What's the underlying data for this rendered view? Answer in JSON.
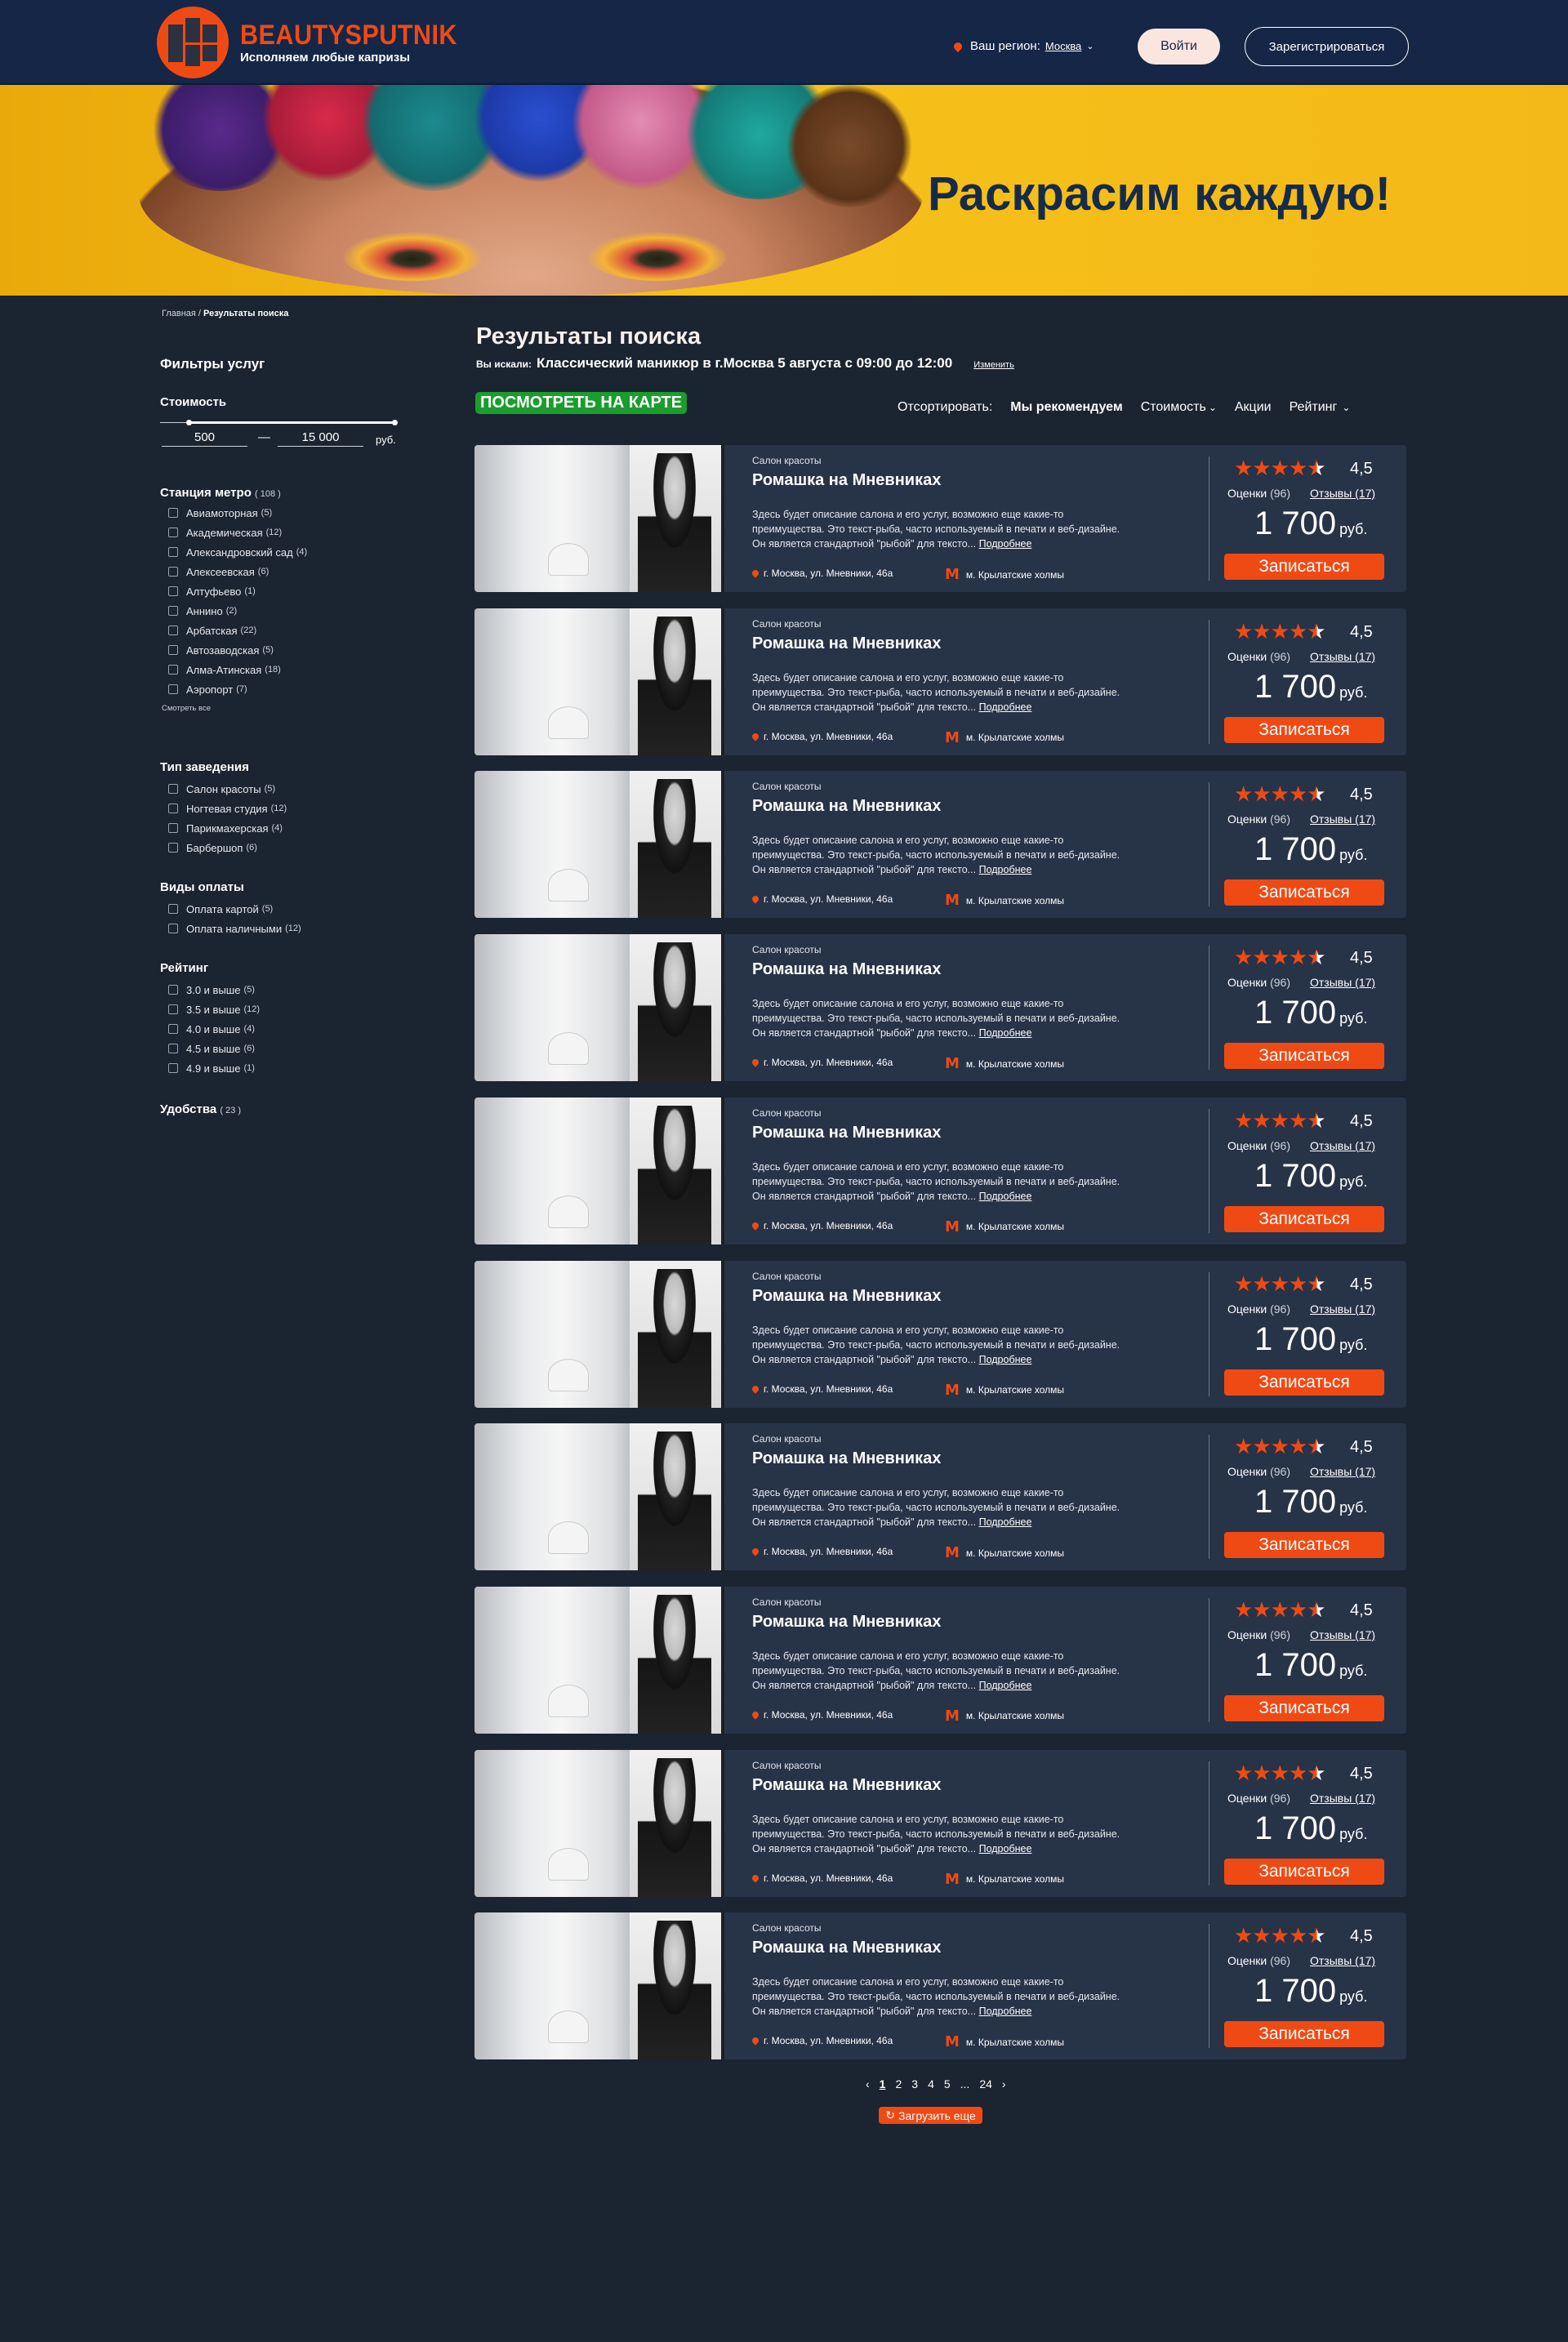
{
  "header": {
    "brand": "BEAUTYSPUTNIK",
    "tagline": "Исполняем любые капризы",
    "region_label": "Ваш регион:",
    "region_value": "Москва",
    "login": "Войти",
    "register": "Зарегистрироваться"
  },
  "banner": {
    "slogan": "Раскрасим каждую!"
  },
  "breadcrumb": {
    "home": "Главная",
    "sep": " / ",
    "current": "Результаты поиска"
  },
  "sidebar": {
    "title": "Фильтры услуг",
    "cost": {
      "label": "Стоимость",
      "from": "500",
      "dash": "—",
      "to": "15 000",
      "unit": "руб."
    },
    "metro": {
      "label": "Станция метро",
      "count": "( 108 )",
      "items": [
        {
          "label": "Авиамоторная",
          "count": "(5)"
        },
        {
          "label": "Академическая",
          "count": "(12)"
        },
        {
          "label": "Александровский сад",
          "count": "(4)"
        },
        {
          "label": "Алексеевская",
          "count": "(6)"
        },
        {
          "label": "Алтуфьево",
          "count": "(1)"
        },
        {
          "label": "Аннино",
          "count": "(2)"
        },
        {
          "label": "Арбатская",
          "count": "(22)"
        },
        {
          "label": "Автозаводская",
          "count": "(5)"
        },
        {
          "label": "Алма-Атинская",
          "count": "(18)"
        },
        {
          "label": "Аэропорт",
          "count": "(7)"
        }
      ],
      "show_all": "Смотреть все"
    },
    "venue": {
      "label": "Тип заведения",
      "items": [
        {
          "label": "Салон красоты",
          "count": "(5)"
        },
        {
          "label": "Ногтевая студия",
          "count": "(12)"
        },
        {
          "label": "Парикмахерская",
          "count": "(4)"
        },
        {
          "label": "Барбершоп",
          "count": "(6)"
        }
      ]
    },
    "payment": {
      "label": "Виды оплаты",
      "items": [
        {
          "label": "Оплата картой",
          "count": "(5)"
        },
        {
          "label": "Оплата наличными",
          "count": "(12)"
        }
      ]
    },
    "rating": {
      "label": "Рейтинг",
      "items": [
        {
          "label": "3.0 и выше",
          "count": "(5)"
        },
        {
          "label": "3.5 и выше",
          "count": "(12)"
        },
        {
          "label": "4.0 и выше",
          "count": "(4)"
        },
        {
          "label": "4.5 и выше",
          "count": "(6)"
        },
        {
          "label": "4.9 и выше",
          "count": "(1)"
        }
      ]
    },
    "amenities": {
      "label": "Удобства",
      "count": "( 23 )"
    }
  },
  "results": {
    "title": "Результаты поиска",
    "query_prefix": "Вы искали:",
    "query": "Классический маникюр в г.Москва 5 августа с 09:00 до 12:00",
    "change": "Изменить",
    "map_button": "ПОСМОТРЕТЬ НА КАРТЕ",
    "sort": {
      "label": "Отсортировать:",
      "options": [
        "Мы рекомендуем",
        "Стоимость",
        "Акции",
        "Рейтинг"
      ]
    }
  },
  "card": {
    "type": "Салон красоты",
    "name": "Ромашка на Мневниках",
    "desc": "Здесь будет описание салона и его услуг, возможно еще какие-то преимущества. Это текст-рыба, часто используемый в печати и веб-дизайне. Он является стандартной \"рыбой\" для тексто...",
    "more": "Подробнее",
    "address": "г. Москва, ул. Мневники, 46а",
    "metro": "м. Крылатские холмы",
    "rating": "4,5",
    "rating_value": 4.5,
    "votes_label": "Оценки",
    "votes_count": "(96)",
    "reviews": "Отзывы (17)",
    "price": "1 700",
    "currency": "руб.",
    "book": "Записаться"
  },
  "pagination": {
    "prev": "‹",
    "pages": [
      "1",
      "2",
      "3",
      "4",
      "5",
      "...",
      "24"
    ],
    "next": "›",
    "load_more": "Загрузить еще"
  },
  "colors": {
    "accent": "#ef4a14",
    "header_bg": "#152647",
    "page_bg": "#1b2431",
    "card_bg": "#273347",
    "map_button": "#1a9d2d",
    "banner_yellow": "#f6c11a"
  }
}
